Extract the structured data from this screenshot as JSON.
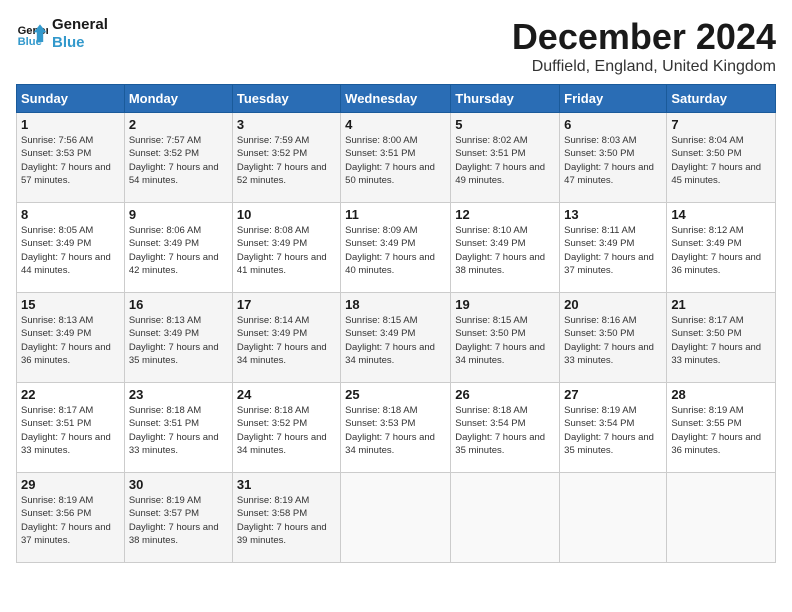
{
  "header": {
    "logo_line1": "General",
    "logo_line2": "Blue",
    "title": "December 2024",
    "location": "Duffield, England, United Kingdom"
  },
  "calendar": {
    "days_of_week": [
      "Sunday",
      "Monday",
      "Tuesday",
      "Wednesday",
      "Thursday",
      "Friday",
      "Saturday"
    ],
    "weeks": [
      [
        {
          "day": "1",
          "sunrise": "7:56 AM",
          "sunset": "3:53 PM",
          "daylight": "7 hours and 57 minutes."
        },
        {
          "day": "2",
          "sunrise": "7:57 AM",
          "sunset": "3:52 PM",
          "daylight": "7 hours and 54 minutes."
        },
        {
          "day": "3",
          "sunrise": "7:59 AM",
          "sunset": "3:52 PM",
          "daylight": "7 hours and 52 minutes."
        },
        {
          "day": "4",
          "sunrise": "8:00 AM",
          "sunset": "3:51 PM",
          "daylight": "7 hours and 50 minutes."
        },
        {
          "day": "5",
          "sunrise": "8:02 AM",
          "sunset": "3:51 PM",
          "daylight": "7 hours and 49 minutes."
        },
        {
          "day": "6",
          "sunrise": "8:03 AM",
          "sunset": "3:50 PM",
          "daylight": "7 hours and 47 minutes."
        },
        {
          "day": "7",
          "sunrise": "8:04 AM",
          "sunset": "3:50 PM",
          "daylight": "7 hours and 45 minutes."
        }
      ],
      [
        {
          "day": "8",
          "sunrise": "8:05 AM",
          "sunset": "3:49 PM",
          "daylight": "7 hours and 44 minutes."
        },
        {
          "day": "9",
          "sunrise": "8:06 AM",
          "sunset": "3:49 PM",
          "daylight": "7 hours and 42 minutes."
        },
        {
          "day": "10",
          "sunrise": "8:08 AM",
          "sunset": "3:49 PM",
          "daylight": "7 hours and 41 minutes."
        },
        {
          "day": "11",
          "sunrise": "8:09 AM",
          "sunset": "3:49 PM",
          "daylight": "7 hours and 40 minutes."
        },
        {
          "day": "12",
          "sunrise": "8:10 AM",
          "sunset": "3:49 PM",
          "daylight": "7 hours and 38 minutes."
        },
        {
          "day": "13",
          "sunrise": "8:11 AM",
          "sunset": "3:49 PM",
          "daylight": "7 hours and 37 minutes."
        },
        {
          "day": "14",
          "sunrise": "8:12 AM",
          "sunset": "3:49 PM",
          "daylight": "7 hours and 36 minutes."
        }
      ],
      [
        {
          "day": "15",
          "sunrise": "8:13 AM",
          "sunset": "3:49 PM",
          "daylight": "7 hours and 36 minutes."
        },
        {
          "day": "16",
          "sunrise": "8:13 AM",
          "sunset": "3:49 PM",
          "daylight": "7 hours and 35 minutes."
        },
        {
          "day": "17",
          "sunrise": "8:14 AM",
          "sunset": "3:49 PM",
          "daylight": "7 hours and 34 minutes."
        },
        {
          "day": "18",
          "sunrise": "8:15 AM",
          "sunset": "3:49 PM",
          "daylight": "7 hours and 34 minutes."
        },
        {
          "day": "19",
          "sunrise": "8:15 AM",
          "sunset": "3:50 PM",
          "daylight": "7 hours and 34 minutes."
        },
        {
          "day": "20",
          "sunrise": "8:16 AM",
          "sunset": "3:50 PM",
          "daylight": "7 hours and 33 minutes."
        },
        {
          "day": "21",
          "sunrise": "8:17 AM",
          "sunset": "3:50 PM",
          "daylight": "7 hours and 33 minutes."
        }
      ],
      [
        {
          "day": "22",
          "sunrise": "8:17 AM",
          "sunset": "3:51 PM",
          "daylight": "7 hours and 33 minutes."
        },
        {
          "day": "23",
          "sunrise": "8:18 AM",
          "sunset": "3:51 PM",
          "daylight": "7 hours and 33 minutes."
        },
        {
          "day": "24",
          "sunrise": "8:18 AM",
          "sunset": "3:52 PM",
          "daylight": "7 hours and 34 minutes."
        },
        {
          "day": "25",
          "sunrise": "8:18 AM",
          "sunset": "3:53 PM",
          "daylight": "7 hours and 34 minutes."
        },
        {
          "day": "26",
          "sunrise": "8:18 AM",
          "sunset": "3:54 PM",
          "daylight": "7 hours and 35 minutes."
        },
        {
          "day": "27",
          "sunrise": "8:19 AM",
          "sunset": "3:54 PM",
          "daylight": "7 hours and 35 minutes."
        },
        {
          "day": "28",
          "sunrise": "8:19 AM",
          "sunset": "3:55 PM",
          "daylight": "7 hours and 36 minutes."
        }
      ],
      [
        {
          "day": "29",
          "sunrise": "8:19 AM",
          "sunset": "3:56 PM",
          "daylight": "7 hours and 37 minutes."
        },
        {
          "day": "30",
          "sunrise": "8:19 AM",
          "sunset": "3:57 PM",
          "daylight": "7 hours and 38 minutes."
        },
        {
          "day": "31",
          "sunrise": "8:19 AM",
          "sunset": "3:58 PM",
          "daylight": "7 hours and 39 minutes."
        },
        null,
        null,
        null,
        null
      ]
    ]
  }
}
